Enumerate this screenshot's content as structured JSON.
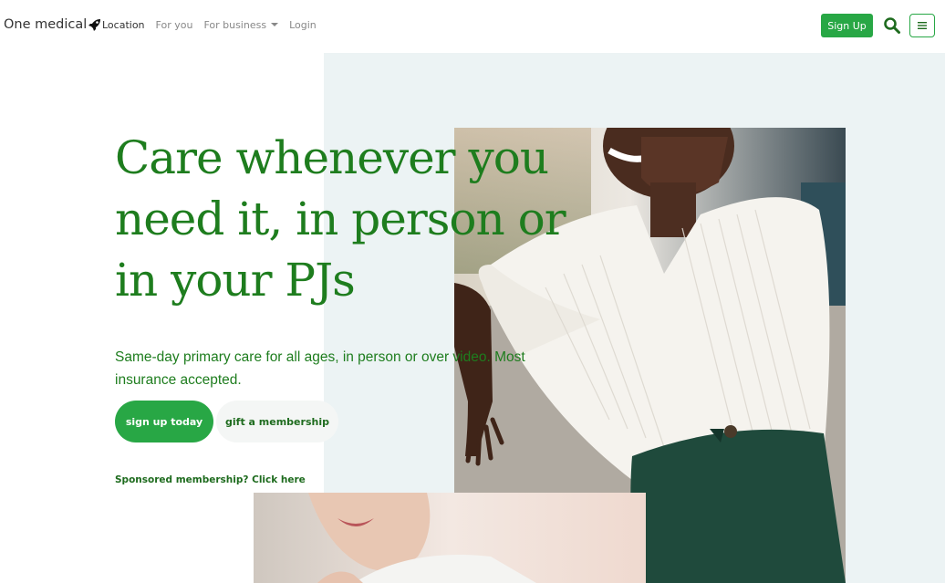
{
  "nav": {
    "brand": "One medical",
    "links": [
      {
        "label": "Location"
      },
      {
        "label": "For you"
      },
      {
        "label": "For business"
      },
      {
        "label": "Login"
      }
    ],
    "signup_label": "Sign Up",
    "icons": {
      "brand": "rocket-icon",
      "search": "search-icon",
      "menu": "hamburger-menu-icon"
    }
  },
  "hero": {
    "headline": "Care whenever you need it, in person or in your PJs",
    "subtext": "Same-day primary care for all ages, in person or over video. Most insurance accepted.",
    "primary_cta": "sign up today",
    "secondary_cta": "gift a membership",
    "sponsored_link": "Sponsored membership? Click here"
  },
  "colors": {
    "brand_green": "#28a745",
    "text_green": "#1e7d1e",
    "hero_bg": "#ecf3f4"
  }
}
